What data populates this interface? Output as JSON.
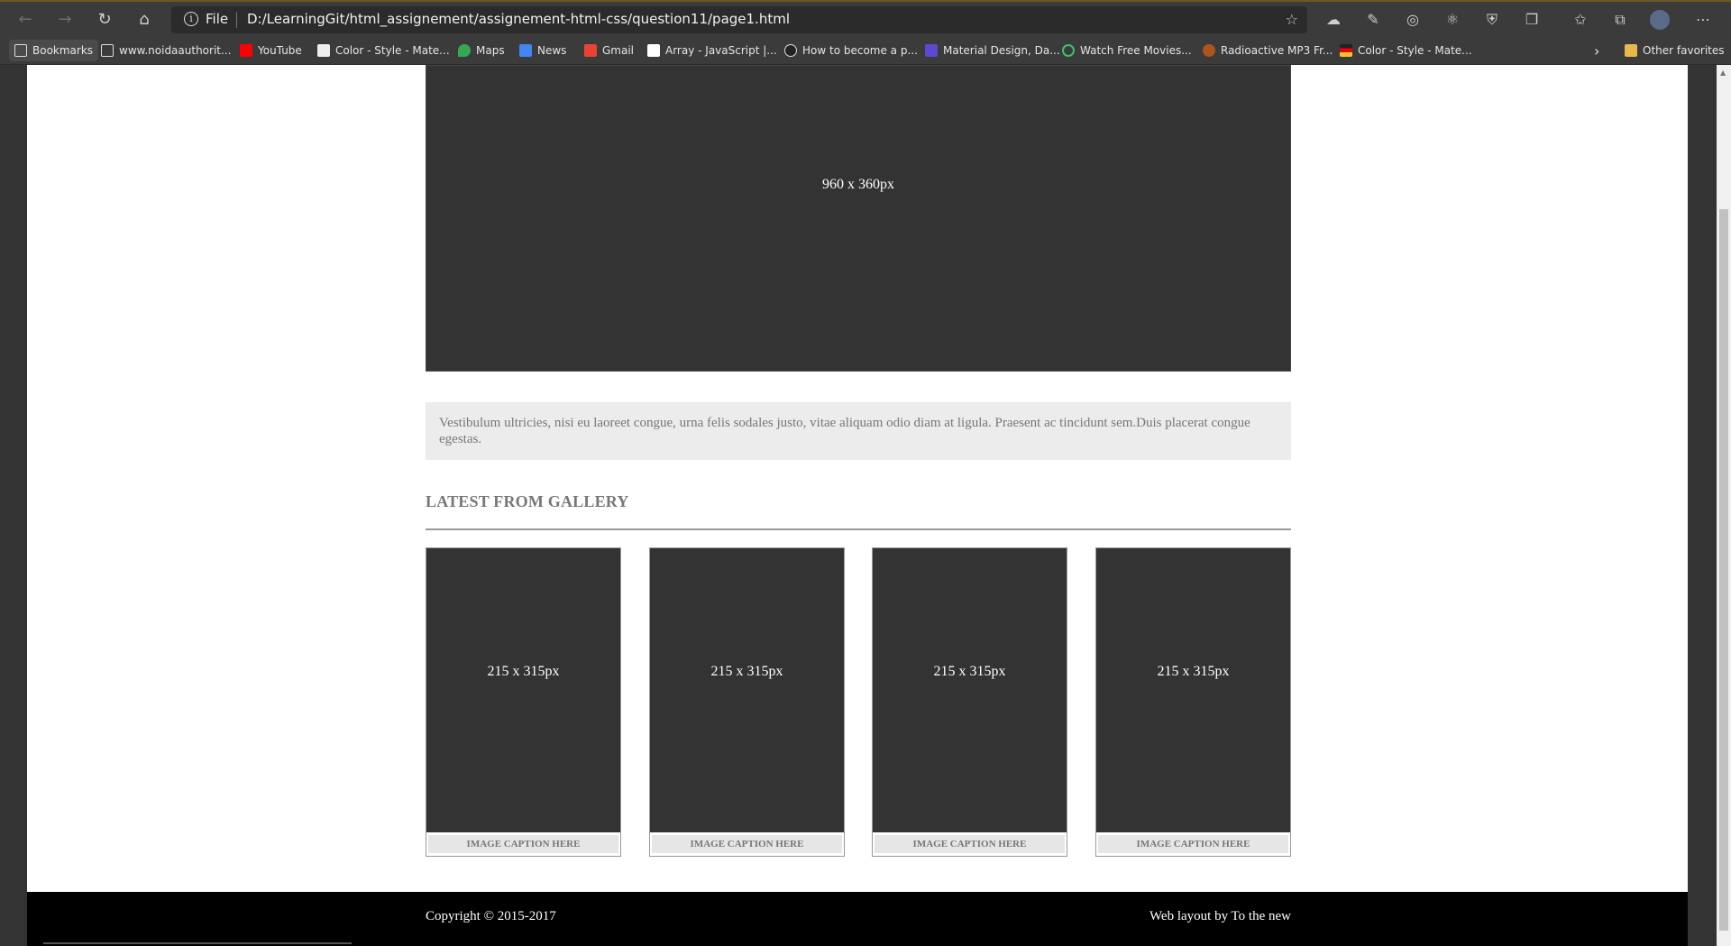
{
  "browser": {
    "address_file_label": "File",
    "url": "D:/LearningGit/html_assignement/assignement-html-css/question11/page1.html",
    "bookmarks": [
      {
        "label": "Bookmarks",
        "color": "#ffffff"
      },
      {
        "label": "www.noidaauthorit...",
        "color": "#ffffff"
      },
      {
        "label": "YouTube",
        "color": "#ff0000"
      },
      {
        "label": "Color - Style - Mate...",
        "color": "#ffffff"
      },
      {
        "label": "Maps",
        "color": "#34a853"
      },
      {
        "label": "News",
        "color": "#4285f4"
      },
      {
        "label": "Gmail",
        "color": "#ea4335"
      },
      {
        "label": "Array - JavaScript |...",
        "color": "#ffffff"
      },
      {
        "label": "How to become a p...",
        "color": "#222222"
      },
      {
        "label": "Material Design, Da...",
        "color": "#5b4ad1"
      },
      {
        "label": "Watch Free Movies...",
        "color": "#3ac16e"
      },
      {
        "label": "Radioactive MP3 Fr...",
        "color": "#b0541c"
      },
      {
        "label": "Color - Style - Mate...",
        "color": "#f4c430"
      }
    ],
    "other_favorites": "Other favorites",
    "more_chevron": "›"
  },
  "page": {
    "hero_label": "960 x 360px",
    "intro_text": "Vestibulum ultricies, nisi eu laoreet congue, urna felis sodales justo, vitae aliquam odio diam at ligula. Praesent ac tincidunt sem.Duis placerat congue egestas.",
    "gallery_title": "LATEST FROM GALLERY",
    "gallery": [
      {
        "image_label": "215 x 315px",
        "caption": "IMAGE CAPTION HERE"
      },
      {
        "image_label": "215 x 315px",
        "caption": "IMAGE CAPTION HERE"
      },
      {
        "image_label": "215 x 315px",
        "caption": "IMAGE CAPTION HERE"
      },
      {
        "image_label": "215 x 315px",
        "caption": "IMAGE CAPTION HERE"
      }
    ],
    "footer_left": "Copyright © 2015-2017",
    "footer_right": "Web layout by To the new"
  },
  "colors": {
    "placeholder_bg": "#333333",
    "footer_bg": "#000000",
    "intro_bg": "#ececec",
    "muted_text": "#777777"
  }
}
